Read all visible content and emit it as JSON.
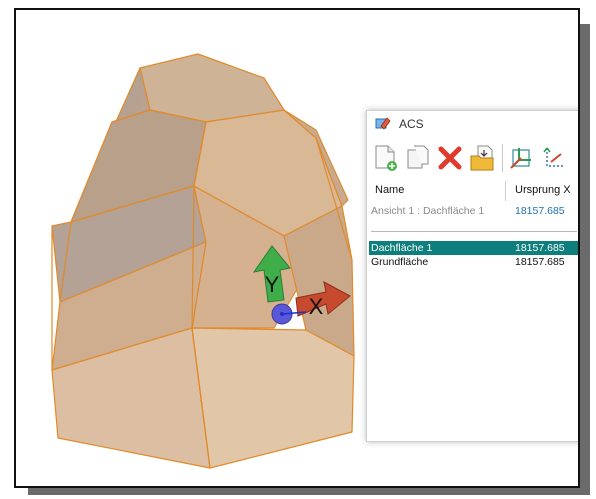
{
  "panel": {
    "title": "ACS",
    "columns": {
      "name": "Name",
      "origin": "Ursprung X"
    },
    "view_row": {
      "name": "Ansicht 1 : Dachfläche 1",
      "origin": "18157.685",
      "origin_color": "#1e6fb8"
    },
    "rows": [
      {
        "name": "Dachfläche 1",
        "origin": "18157.685",
        "selected": true
      },
      {
        "name": "Grundfläche",
        "origin": "18157.685",
        "selected": false
      }
    ],
    "selection_color": "#0f7f7d",
    "toolbar": [
      "new-page-icon",
      "copy-page-icon",
      "delete-icon",
      "import-folder-icon",
      "coordinate-system-icon",
      "axes-icon"
    ]
  },
  "viewport": {
    "model": "roof-solid",
    "axis_labels": {
      "y": "Y",
      "x": "X"
    },
    "edge_color": "#e08a2a",
    "y_arrow_color": "#3fae49",
    "x_arrow_color": "#c84a2e",
    "origin_color": "#5a58d6"
  }
}
